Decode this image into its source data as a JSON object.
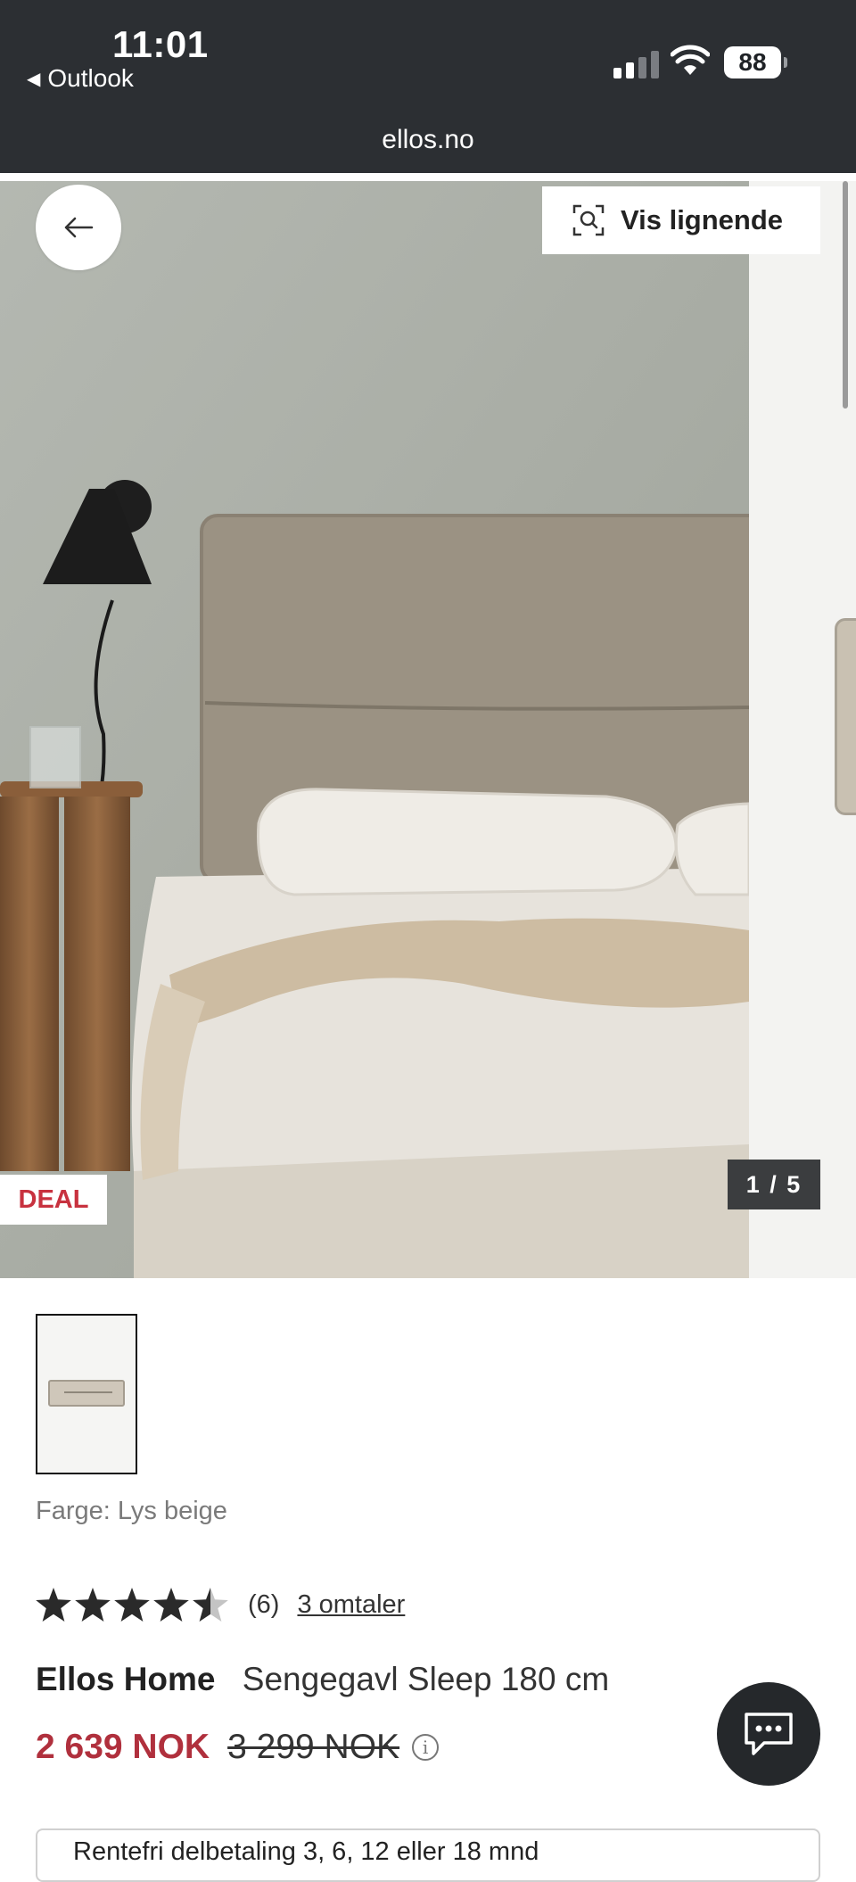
{
  "status_bar": {
    "time": "11:01",
    "back_app": "Outlook",
    "battery": "88",
    "url": "ellos.no"
  },
  "gallery": {
    "similar_label": "Vis lignende",
    "deal_badge": "DEAL",
    "counter": "1 / 5",
    "icons": [
      "arrow-left-icon",
      "visual-search-icon"
    ]
  },
  "product": {
    "color_label": "Farge: Lys beige",
    "rating_value": 4.5,
    "rating_count": "(6)",
    "reviews_link": "3 omtaler",
    "brand": "Ellos Home",
    "name": "Sengegavl Sleep 180 cm",
    "price_now": "2 639 NOK",
    "price_old": "3 299 NOK",
    "payment_text": "Rentefri delbetaling 3, 6, 12 eller 18 mnd"
  },
  "colors": {
    "sale_red": "#b0303d",
    "dark": "#2c2f33"
  }
}
